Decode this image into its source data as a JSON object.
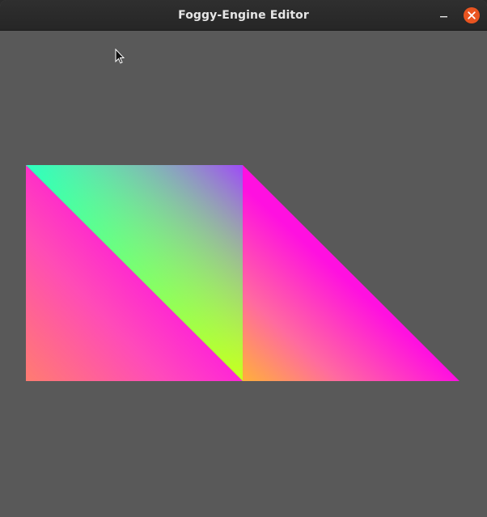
{
  "window": {
    "title": "Foggy-Engine Editor",
    "background_color": "#595959",
    "accent_close_color": "#e95420"
  },
  "controls": {
    "minimize_icon": "minimize-icon",
    "close_icon": "close-icon"
  },
  "scene": {
    "shapes": [
      {
        "name": "triangle-left-lower",
        "vertex_colors": [
          "#ff00ff",
          "#ffc040",
          "#ff00ff"
        ]
      },
      {
        "name": "triangle-left-upper",
        "vertex_colors": [
          "#30ffc0",
          "#a040ff",
          "#c0ff20"
        ]
      },
      {
        "name": "triangle-right",
        "vertex_colors": [
          "#ff00ff",
          "#ffc040",
          "#ff00ff"
        ]
      }
    ]
  }
}
